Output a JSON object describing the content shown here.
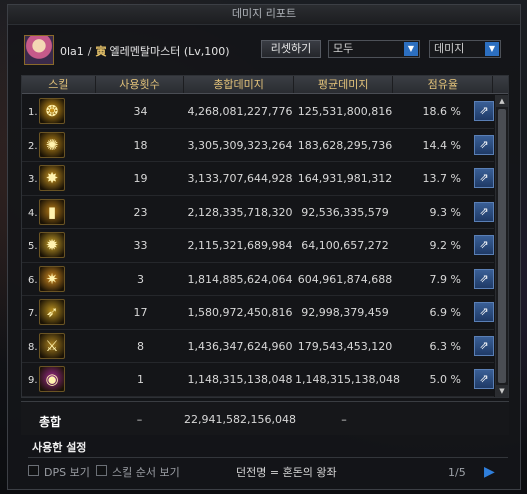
{
  "window": {
    "title": "데미지 리포트"
  },
  "character": {
    "level_prefix": "0la1",
    "separator": "/",
    "guild_icon": "寅",
    "name": "엘레멘탈마스터 (Lv,100)"
  },
  "controls": {
    "reset_label": "리셋하기",
    "scope_value": "모두",
    "metric_value": "데미지"
  },
  "columns": [
    "스킬",
    "사용횟수",
    "총합데미지",
    "평균데미지",
    "점유율"
  ],
  "skills": [
    {
      "rank": "1.",
      "icon_glyph": "❂",
      "icon_color": "#d49a1a",
      "count": "34",
      "total": "4,268,081,227,776",
      "avg": "125,531,800,816",
      "share": "18.6 %"
    },
    {
      "rank": "2.",
      "icon_glyph": "✺",
      "icon_color": "#b8861a",
      "count": "18",
      "total": "3,305,309,323,264",
      "avg": "183,628,295,736",
      "share": "14.4 %"
    },
    {
      "rank": "3.",
      "icon_glyph": "✸",
      "icon_color": "#c79422",
      "count": "19",
      "total": "3,133,707,644,928",
      "avg": "164,931,981,312",
      "share": "13.7 %"
    },
    {
      "rank": "4.",
      "icon_glyph": "▮",
      "icon_color": "#b37a18",
      "count": "23",
      "total": "2,128,335,718,320",
      "avg": "92,536,335,579",
      "share": "9.3 %"
    },
    {
      "rank": "5.",
      "icon_glyph": "✹",
      "icon_color": "#c9a12a",
      "count": "33",
      "total": "2,115,321,689,984",
      "avg": "64,100,657,272",
      "share": "9.2 %"
    },
    {
      "rank": "6.",
      "icon_glyph": "✷",
      "icon_color": "#d08a20",
      "count": "3",
      "total": "1,814,885,624,064",
      "avg": "604,961,874,688",
      "share": "7.9 %"
    },
    {
      "rank": "7.",
      "icon_glyph": "➶",
      "icon_color": "#b89020",
      "count": "17",
      "total": "1,580,972,450,816",
      "avg": "92,998,379,459",
      "share": "6.9 %"
    },
    {
      "rank": "8.",
      "icon_glyph": "⚔",
      "icon_color": "#a88020",
      "count": "8",
      "total": "1,436,347,624,960",
      "avg": "179,543,453,120",
      "share": "6.3 %"
    },
    {
      "rank": "9.",
      "icon_glyph": "◉",
      "icon_color": "#9a2a8a",
      "count": "1",
      "total": "1,148,315,138,048",
      "avg": "1,148,315,138,048",
      "share": "5.0 %"
    }
  ],
  "totals": {
    "label": "총합",
    "count": "–",
    "total": "22,941,582,156,048",
    "avg": "–"
  },
  "section_tab": "사용한 설정",
  "footer": {
    "dps_label": "DPS 보기",
    "order_label": "스킬 순서 보기",
    "dungeon": "던전명 = 혼돈의 왕좌",
    "page": "1/5"
  }
}
